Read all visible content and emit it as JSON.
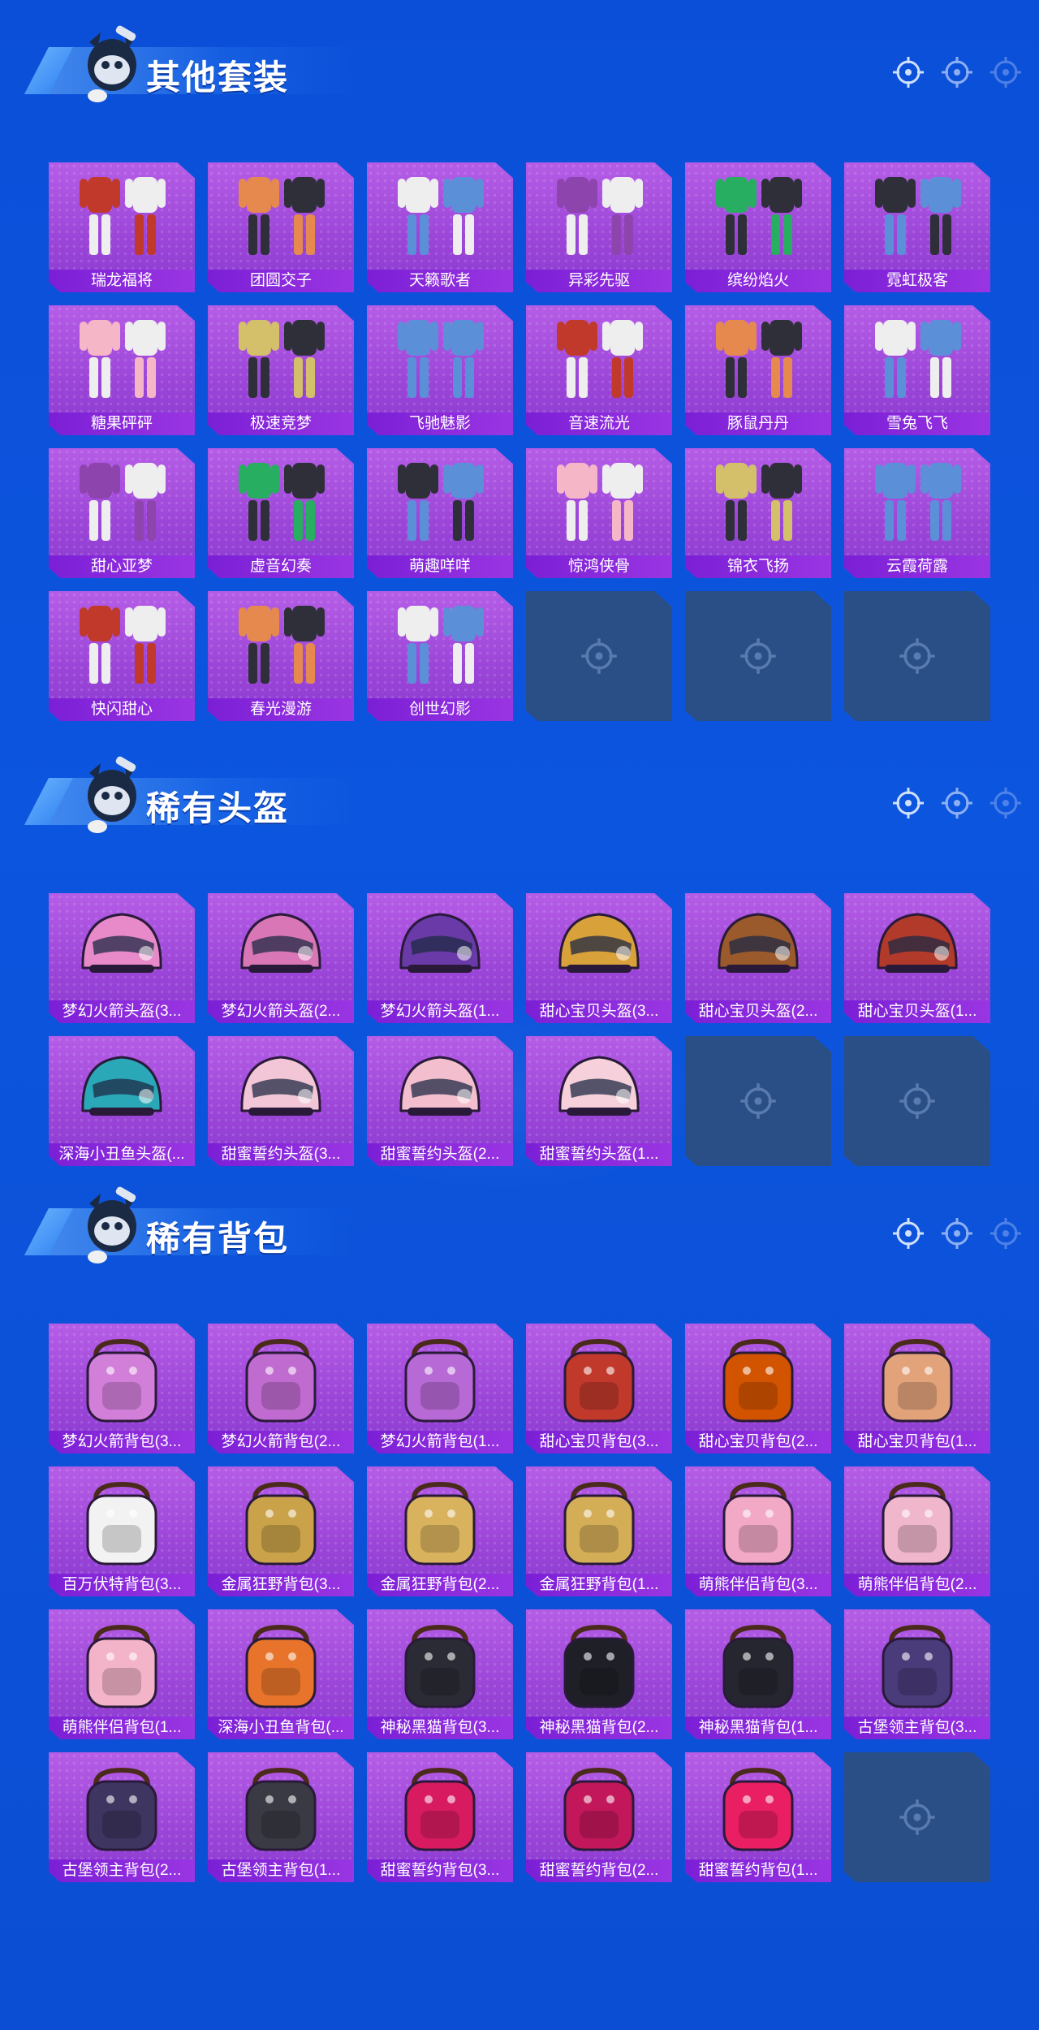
{
  "sections": [
    {
      "title": "其他套装",
      "kind": "outfit",
      "items": [
        "瑞龙福将",
        "团圆交子",
        "天籁歌者",
        "异彩先驱",
        "缤纷焰火",
        "霓虹极客",
        "糖果砰砰",
        "极速竞梦",
        "飞驰魅影",
        "音速流光",
        "豚鼠丹丹",
        "雪兔飞飞",
        "甜心亚梦",
        "虚音幻奏",
        "萌趣咩咩",
        "惊鸿侠骨",
        "锦衣飞扬",
        "云霞荷露",
        "快闪甜心",
        "春光漫游",
        "创世幻影"
      ],
      "empty_slots": 3
    },
    {
      "title": "稀有头盔",
      "kind": "helmet",
      "items": [
        "梦幻火箭头盔(3...",
        "梦幻火箭头盔(2...",
        "梦幻火箭头盔(1...",
        "甜心宝贝头盔(3...",
        "甜心宝贝头盔(2...",
        "甜心宝贝头盔(1...",
        "深海小丑鱼头盔(...",
        "甜蜜誓约头盔(3...",
        "甜蜜誓约头盔(2...",
        "甜蜜誓约头盔(1..."
      ],
      "empty_slots": 2
    },
    {
      "title": "稀有背包",
      "kind": "backpack",
      "items": [
        "梦幻火箭背包(3...",
        "梦幻火箭背包(2...",
        "梦幻火箭背包(1...",
        "甜心宝贝背包(3...",
        "甜心宝贝背包(2...",
        "甜心宝贝背包(1...",
        "百万伏特背包(3...",
        "金属狂野背包(3...",
        "金属狂野背包(2...",
        "金属狂野背包(1...",
        "萌熊伴侣背包(3...",
        "萌熊伴侣背包(2...",
        "萌熊伴侣背包(1...",
        "深海小丑鱼背包(...",
        "神秘黑猫背包(3...",
        "神秘黑猫背包(2...",
        "神秘黑猫背包(1...",
        "古堡领主背包(3...",
        "古堡领主背包(2...",
        "古堡领主背包(1...",
        "甜蜜誓约背包(3...",
        "甜蜜誓约背包(2...",
        "甜蜜誓约背包(1..."
      ],
      "empty_slots": 1
    }
  ],
  "icons": {
    "mascot": "mascot-icon",
    "crosshair": "crosshair-icon",
    "empty_slot": "crosshair-icon"
  },
  "colors": {
    "background": "#0c55de",
    "card": "#a54fdf",
    "label_bar": "#8a2be0",
    "empty_card": "#2a4f86"
  }
}
